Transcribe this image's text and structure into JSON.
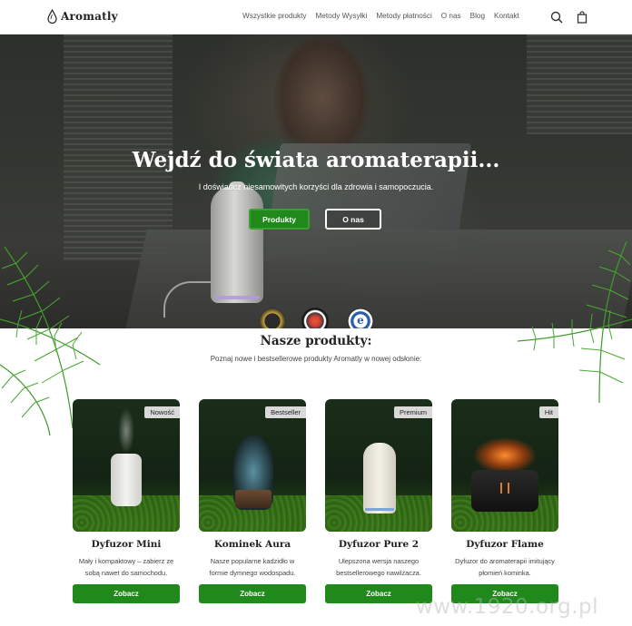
{
  "brand": {
    "name": "Aromatly",
    "logo_icon": "drop-icon"
  },
  "nav": {
    "items": [
      {
        "label": "Wszystkie produkty"
      },
      {
        "label": "Metody Wysyłki"
      },
      {
        "label": "Metody płatności"
      },
      {
        "label": "O nas"
      },
      {
        "label": "Blog"
      },
      {
        "label": "Kontakt"
      }
    ],
    "icons": [
      "search-icon",
      "bag-icon"
    ]
  },
  "hero": {
    "title": "Wejdź do świata aromaterapii...",
    "subtitle": "I doświadcz niesamowitych korzyści dla zdrowia i samopoczucia.",
    "primary_button": "Produkty",
    "secondary_button": "O nas",
    "badges": [
      "quality-badge",
      "ecommerce-badge",
      "trusted-shops-badge"
    ],
    "badge_3_letter": "e"
  },
  "products_section": {
    "title": "Nasze produkty:",
    "subtitle": "Poznaj nowe i bestsellerowe produkty Aromatly w nowej odsłonie:",
    "items": [
      {
        "tag": "Nowość",
        "name": "Dyfuzor Mini",
        "desc": "Mały i kompaktowy – zabierz ze sobą nawet do samochodu.",
        "button": "Zobacz"
      },
      {
        "tag": "Bestseller",
        "name": "Kominek Aura",
        "desc": "Nasze popularne kadzidło w formie dymnego wodospadu.",
        "button": "Zobacz"
      },
      {
        "tag": "Premium",
        "name": "Dyfuzor Pure 2",
        "desc": "Ulepszona wersja naszego bestsellerowego nawilżacza.",
        "button": "Zobacz"
      },
      {
        "tag": "Hit",
        "name": "Dyfuzor Flame",
        "desc": "Dyfuzor do aromaterapii imitujący płomień kominka.",
        "button": "Zobacz"
      }
    ]
  },
  "watermark": "www.1920.org.pl",
  "colors": {
    "accent": "#1f8a1b",
    "header_bg": "#ffffff",
    "tag_bg": "#d9d9d9"
  }
}
